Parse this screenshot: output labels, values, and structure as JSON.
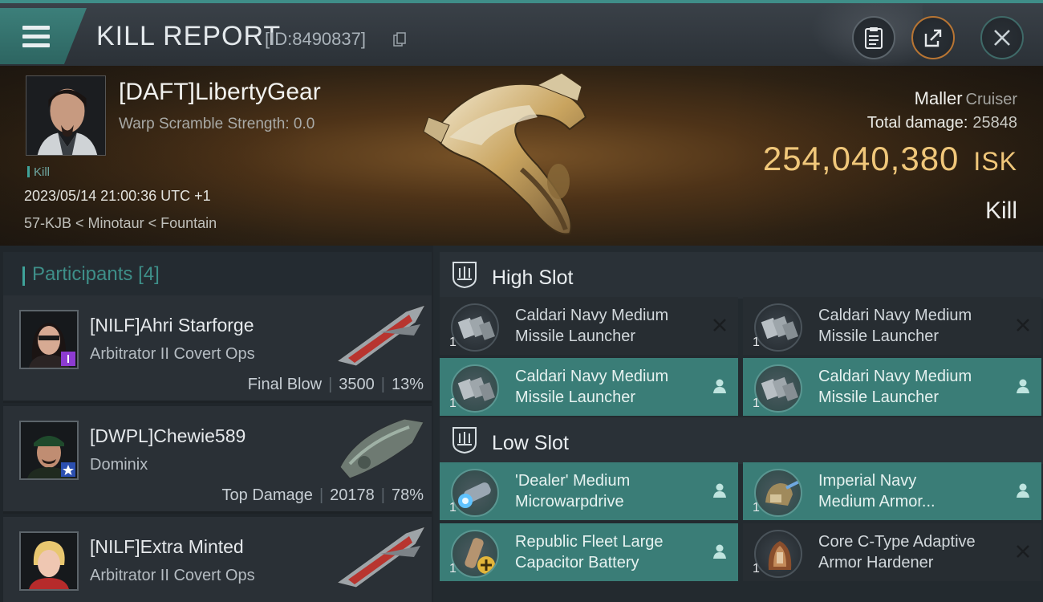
{
  "header": {
    "title": "KILL REPORT",
    "report_id": "[ID:8490837]"
  },
  "victim": {
    "name": "[DAFT]LibertyGear",
    "warp_scramble": "Warp Scramble Strength: 0.0",
    "kill_tag": "Kill",
    "datetime": "2023/05/14 21:00:36 UTC +1",
    "location": "57-KJB < Minotaur < Fountain",
    "ship_name": "Maller",
    "ship_class": "Cruiser",
    "total_damage_label": "Total damage:",
    "total_damage": "25848",
    "isk_value": "254,040,380",
    "isk_unit": "ISK",
    "result": "Kill"
  },
  "participants": {
    "label": "Participants",
    "count": "[4]",
    "rows": [
      {
        "name": "[NILF]Ahri Starforge",
        "ship": "Arbitrator II Covert Ops",
        "role": "Final Blow",
        "damage": "3500",
        "percent": "13%"
      },
      {
        "name": "[DWPL]Chewie589",
        "ship": "Dominix",
        "role": "Top Damage",
        "damage": "20178",
        "percent": "78%"
      },
      {
        "name": "[NILF]Extra Minted",
        "ship": "Arbitrator II Covert Ops",
        "role": "",
        "damage": "",
        "percent": ""
      }
    ]
  },
  "slots": {
    "high": {
      "title": "High Slot",
      "modules": [
        {
          "line1": "Caldari Navy Medium",
          "line2": "Missile Launcher",
          "qty": "1",
          "state": "destroyed"
        },
        {
          "line1": "Caldari Navy Medium",
          "line2": "Missile Launcher",
          "qty": "1",
          "state": "destroyed"
        },
        {
          "line1": "Caldari Navy Medium",
          "line2": "Missile Launcher",
          "qty": "1",
          "state": "dropped"
        },
        {
          "line1": "Caldari Navy Medium",
          "line2": "Missile Launcher",
          "qty": "1",
          "state": "dropped"
        }
      ]
    },
    "low": {
      "title": "Low Slot",
      "modules": [
        {
          "line1": "'Dealer' Medium",
          "line2": "Microwarpdrive",
          "qty": "1",
          "state": "dropped"
        },
        {
          "line1": "Imperial Navy",
          "line2": "Medium Armor...",
          "qty": "1",
          "state": "dropped"
        },
        {
          "line1": "Republic Fleet Large",
          "line2": "Capacitor Battery",
          "qty": "1",
          "state": "dropped"
        },
        {
          "line1": "Core C-Type Adaptive",
          "line2": "Armor Hardener",
          "qty": "1",
          "state": "destroyed"
        }
      ]
    }
  },
  "colors": {
    "accent_teal": "#3f8e88",
    "isk_gold": "#f0c77a",
    "fitted_row": "#3a7d77"
  }
}
